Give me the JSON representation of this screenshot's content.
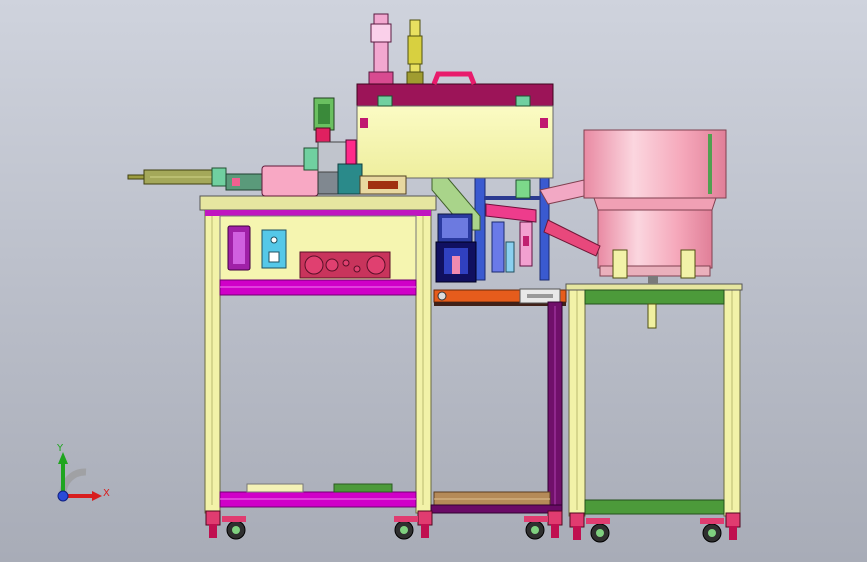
{
  "axis_triad": {
    "y_label": "Y",
    "x_label": "X"
  },
  "colors": {
    "background": "#c2c6d0",
    "frame_yellow": "#f2f2a8",
    "frame_magenta": "#d000c8",
    "bowl_pink": "#f7b4c4",
    "deck_green": "#4c9a3a",
    "rail_orange": "#e65c1c"
  }
}
